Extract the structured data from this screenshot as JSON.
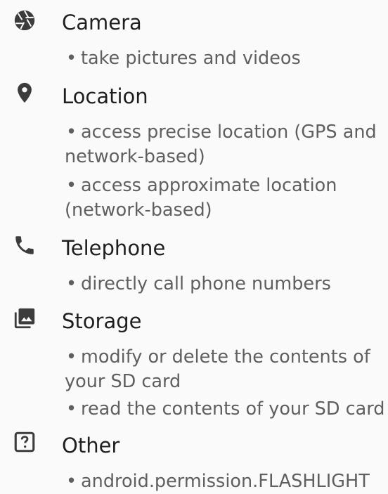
{
  "groups": [
    {
      "id": "camera",
      "icon": "camera-icon",
      "title": "Camera",
      "items": [
        "take pictures and videos"
      ]
    },
    {
      "id": "location",
      "icon": "location-pin-icon",
      "title": "Location",
      "items": [
        "access precise location (GPS and network-based)",
        "access approximate location (network-based)"
      ]
    },
    {
      "id": "telephone",
      "icon": "phone-icon",
      "title": "Telephone",
      "items": [
        "directly call phone numbers"
      ]
    },
    {
      "id": "storage",
      "icon": "photo-library-icon",
      "title": "Storage",
      "items": [
        "modify or delete the contents of your SD card",
        "read the contents of your SD card"
      ]
    },
    {
      "id": "other",
      "icon": "question-box-icon",
      "title": "Other",
      "items": [
        "android.permission.FLASHLIGHT"
      ]
    }
  ],
  "bullet": "•",
  "colors": {
    "icon": "#3c3c3c",
    "title": "#1f1f1f",
    "item": "#5f5f5f",
    "background": "#fafafa"
  }
}
